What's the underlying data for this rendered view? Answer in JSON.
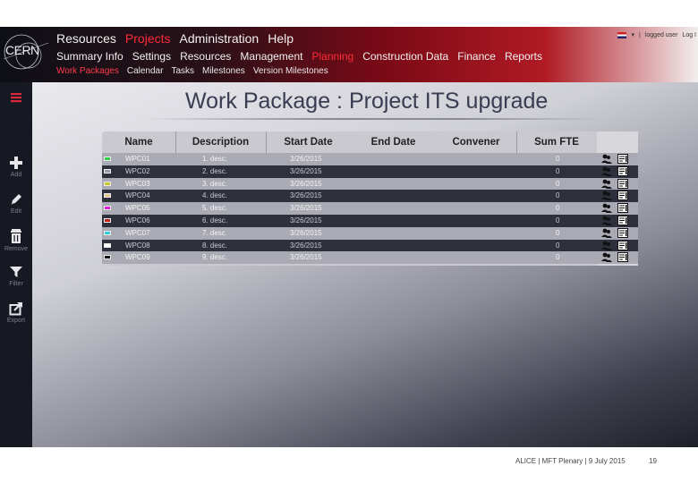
{
  "logo": {
    "text": "CERN"
  },
  "menu_top": [
    {
      "label": "Resources",
      "active": false
    },
    {
      "label": "Projects",
      "active": true
    },
    {
      "label": "Administration",
      "active": false
    },
    {
      "label": "Help",
      "active": false
    }
  ],
  "menu_second": [
    {
      "label": "Summary Info",
      "active": false
    },
    {
      "label": "Settings",
      "active": false
    },
    {
      "label": "Resources",
      "active": false
    },
    {
      "label": "Management",
      "active": false
    },
    {
      "label": "Planning",
      "active": true
    },
    {
      "label": "Construction Data",
      "active": false
    },
    {
      "label": "Finance",
      "active": false
    },
    {
      "label": "Reports",
      "active": false
    }
  ],
  "menu_third": [
    {
      "label": "Work Packages",
      "active": true
    },
    {
      "label": "Calendar",
      "active": false
    },
    {
      "label": "Tasks",
      "active": false
    },
    {
      "label": "Milestones",
      "active": false
    },
    {
      "label": "Version Milestones",
      "active": false
    }
  ],
  "topright": {
    "user": "logged user",
    "logout": "Log I"
  },
  "sidebar": [
    {
      "label": "",
      "icon": "menu-icon"
    },
    {
      "label": "Add",
      "icon": "plus-icon"
    },
    {
      "label": "Edit",
      "icon": "pencil-icon"
    },
    {
      "label": "Remove",
      "icon": "trash-icon"
    },
    {
      "label": "Filter",
      "icon": "filter-icon"
    },
    {
      "label": "Export",
      "icon": "export-icon"
    }
  ],
  "page": {
    "title": "Work Package : Project ITS upgrade"
  },
  "table": {
    "columns": [
      "Name",
      "Description",
      "Start Date",
      "End Date",
      "Convener",
      "Sum FTE"
    ],
    "rows": [
      {
        "color": "#2fd04a",
        "name": "WPC01",
        "desc": "1. desc.",
        "start": "3/26/2015",
        "end": "",
        "convener": "",
        "fte": "0"
      },
      {
        "color": "#9a9ca6",
        "name": "WPC02",
        "desc": "2. desc.",
        "start": "3/26/2015",
        "end": "",
        "convener": "",
        "fte": "0"
      },
      {
        "color": "#c8c82a",
        "name": "WPC03",
        "desc": "3. desc.",
        "start": "3/26/2015",
        "end": "",
        "convener": "",
        "fte": "0"
      },
      {
        "color": "#e8c890",
        "name": "WPC04",
        "desc": "4. desc.",
        "start": "3/26/2015",
        "end": "",
        "convener": "",
        "fte": "0"
      },
      {
        "color": "#e020e0",
        "name": "WPC05",
        "desc": "5. desc.",
        "start": "3/26/2015",
        "end": "",
        "convener": "",
        "fte": "0"
      },
      {
        "color": "#c02020",
        "name": "WPC06",
        "desc": "6. desc.",
        "start": "3/26/2015",
        "end": "",
        "convener": "",
        "fte": "0"
      },
      {
        "color": "#30d0e0",
        "name": "WPC07",
        "desc": "7. desc.",
        "start": "3/26/2015",
        "end": "",
        "convener": "",
        "fte": "0"
      },
      {
        "color": "#ffffff",
        "name": "WPC08",
        "desc": "8. desc.",
        "start": "3/26/2015",
        "end": "",
        "convener": "",
        "fte": "0"
      },
      {
        "color": "#101010",
        "name": "WPC09",
        "desc": "9. desc.",
        "start": "3/26/2015",
        "end": "",
        "convener": "",
        "fte": "0"
      }
    ]
  },
  "footer": {
    "text": "ALICE | MFT Plenary | 9 July 2015",
    "page": "19"
  },
  "colors": {
    "accent": "#ff2b3b",
    "sidebar": "#171922",
    "header_red": "#b01a24"
  }
}
